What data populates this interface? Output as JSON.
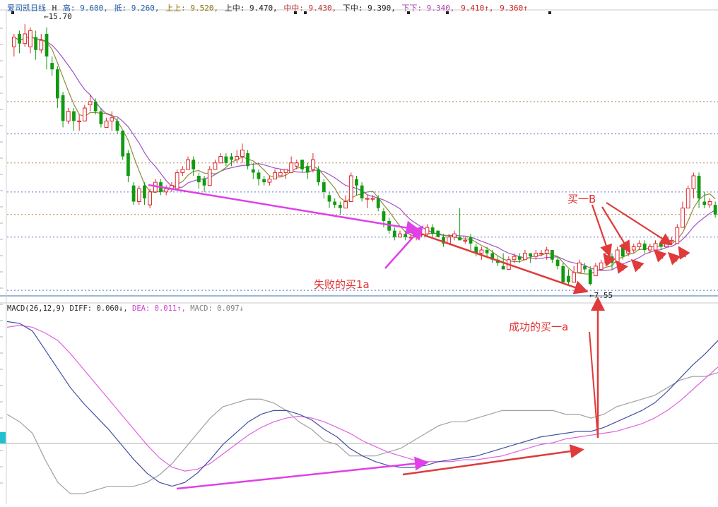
{
  "header": {
    "title": "爱司凯日线",
    "fields": [
      {
        "text": "H",
        "color": "#202020"
      },
      {
        "text": "高: 9.600,",
        "color": "#1e5aa8"
      },
      {
        "text": "抵: 9.260,",
        "color": "#1e5aa8"
      },
      {
        "text": "上上: 9.520,",
        "color": "#8a6a00"
      },
      {
        "text": "上中: 9.470,",
        "color": "#202020"
      },
      {
        "text": "中中: 9.430,",
        "color": "#c03030"
      },
      {
        "text": "下中: 9.390,",
        "color": "#202020"
      },
      {
        "text": "下下: 9.340,",
        "color": "#b040b0"
      },
      {
        "text": "9.410↑,",
        "color": "#d02020"
      },
      {
        "text": "9.360↑",
        "color": "#d02020"
      }
    ]
  },
  "macd_header": {
    "label": "MACD(26,12,9)",
    "diff": "DIFF: 0.060↓,",
    "dea": "DEA: 0.011↑,",
    "macd": "MACD: 0.097↓"
  },
  "price_labels": {
    "high": "15.70",
    "low": "7.55"
  },
  "annotations": {
    "failed_buy": "失败的买1a",
    "success_buy": "成功的买一a",
    "buy_b": "买一B"
  },
  "colors": {
    "up": "#e0242a",
    "down": "#109a10",
    "ma_fast": "#8c8c3a",
    "ma_slow": "#a050c8",
    "diff_line": "#4050a0",
    "dea_line": "#e060e0",
    "macd_line": "#a0a0a0",
    "magenta_arrow": "#e040e8",
    "red_arrow": "#e03a3a",
    "hgrid_brown": "#a06a2a",
    "hgrid_blue": "#3050c0"
  },
  "chart_data": [
    {
      "type": "candlestick",
      "title": "爱司凯日线",
      "ylim": [
        7.2,
        16.0
      ],
      "reference_levels": [
        13.2,
        12.2,
        11.3,
        10.4,
        9.7,
        9.0,
        7.35
      ],
      "candles": [
        [
          14.9,
          15.2,
          14.6,
          15.3
        ],
        [
          15.3,
          15.0,
          14.7,
          15.4
        ],
        [
          15.0,
          15.3,
          14.9,
          15.6
        ],
        [
          14.9,
          15.4,
          14.7,
          15.5
        ],
        [
          15.2,
          14.8,
          14.5,
          15.4
        ],
        [
          14.8,
          15.1,
          14.7,
          15.3
        ],
        [
          15.3,
          14.6,
          14.2,
          15.5
        ],
        [
          14.4,
          14.2,
          14.0,
          14.6
        ],
        [
          14.2,
          13.3,
          13.0,
          14.3
        ],
        [
          13.4,
          12.6,
          12.4,
          13.5
        ],
        [
          12.6,
          12.9,
          12.5,
          13.0
        ],
        [
          12.9,
          12.6,
          12.3,
          13.0
        ],
        [
          12.6,
          12.6,
          12.3,
          12.8
        ],
        [
          12.6,
          13.0,
          12.8,
          13.1
        ],
        [
          13.1,
          13.2,
          12.9,
          13.4
        ],
        [
          13.2,
          12.9,
          12.8,
          13.3
        ],
        [
          12.9,
          12.5,
          12.4,
          13.0
        ],
        [
          12.4,
          12.6,
          12.4,
          12.7
        ],
        [
          12.6,
          12.7,
          12.3,
          12.9
        ],
        [
          12.6,
          12.3,
          12.2,
          12.7
        ],
        [
          12.3,
          11.5,
          11.4,
          12.3
        ],
        [
          11.6,
          10.9,
          10.7,
          11.7
        ],
        [
          10.6,
          10.1,
          10.0,
          10.7
        ],
        [
          10.1,
          10.5,
          10.0,
          10.6
        ],
        [
          10.6,
          10.2,
          10.0,
          10.7
        ],
        [
          10.0,
          10.4,
          9.9,
          10.5
        ],
        [
          10.4,
          10.7,
          10.6,
          10.8
        ],
        [
          10.7,
          10.4,
          10.3,
          10.8
        ],
        [
          10.4,
          10.5,
          10.3,
          10.6
        ],
        [
          10.5,
          10.6,
          10.4,
          10.7
        ],
        [
          10.5,
          11.0,
          10.9,
          11.1
        ],
        [
          11.0,
          11.1,
          10.9,
          11.2
        ],
        [
          11.1,
          11.4,
          11.2,
          11.5
        ],
        [
          11.4,
          11.1,
          10.9,
          11.5
        ],
        [
          10.9,
          10.7,
          10.5,
          11.0
        ],
        [
          10.8,
          10.6,
          10.4,
          10.9
        ],
        [
          10.6,
          11.1,
          11.0,
          11.2
        ],
        [
          11.1,
          11.3,
          11.1,
          11.4
        ],
        [
          11.3,
          11.5,
          11.3,
          11.6
        ],
        [
          11.5,
          11.3,
          11.2,
          11.6
        ],
        [
          11.5,
          11.4,
          11.2,
          11.6
        ],
        [
          11.4,
          11.5,
          11.3,
          11.7
        ],
        [
          11.5,
          11.7,
          11.3,
          11.9
        ],
        [
          11.6,
          11.2,
          11.1,
          11.7
        ],
        [
          11.1,
          11.0,
          10.8,
          11.3
        ],
        [
          11.0,
          10.8,
          10.6,
          11.1
        ],
        [
          10.8,
          10.7,
          10.6,
          10.9
        ],
        [
          10.7,
          10.8,
          10.6,
          10.9
        ],
        [
          10.8,
          11.0,
          10.8,
          11.1
        ],
        [
          10.9,
          11.0,
          10.9,
          11.1
        ],
        [
          11.0,
          11.1,
          10.8,
          11.1
        ],
        [
          11.0,
          11.3,
          11.1,
          11.5
        ],
        [
          11.2,
          11.3,
          11.1,
          11.4
        ],
        [
          11.4,
          11.1,
          11.0,
          11.4
        ],
        [
          11.2,
          11.0,
          10.8,
          11.3
        ],
        [
          11.1,
          11.4,
          11.0,
          11.6
        ],
        [
          11.1,
          10.7,
          10.6,
          11.2
        ],
        [
          10.7,
          10.4,
          10.2,
          10.8
        ],
        [
          10.3,
          10.1,
          9.9,
          10.4
        ],
        [
          10.1,
          10.0,
          9.9,
          10.2
        ],
        [
          10.0,
          9.9,
          9.7,
          10.1
        ],
        [
          9.9,
          10.1,
          9.9,
          10.3
        ],
        [
          10.1,
          10.9,
          10.1,
          11.0
        ],
        [
          10.8,
          10.6,
          10.3,
          10.9
        ],
        [
          10.6,
          10.2,
          10.1,
          10.7
        ],
        [
          10.2,
          10.2,
          9.9,
          10.3
        ],
        [
          10.2,
          10.2,
          10.1,
          10.3
        ],
        [
          10.2,
          9.9,
          9.8,
          10.3
        ],
        [
          9.8,
          9.5,
          9.3,
          9.9
        ],
        [
          9.5,
          9.2,
          9.1,
          9.6
        ],
        [
          9.2,
          9.0,
          8.9,
          9.3
        ],
        [
          9.0,
          9.1,
          9.0,
          9.2
        ],
        [
          9.1,
          9.0,
          8.9,
          9.2
        ],
        [
          9.0,
          9.0,
          8.9,
          9.1
        ],
        [
          9.0,
          9.1,
          8.9,
          9.2
        ],
        [
          9.1,
          9.1,
          9.0,
          9.2
        ],
        [
          9.1,
          9.3,
          9.0,
          9.4
        ],
        [
          9.3,
          9.1,
          9.0,
          9.4
        ],
        [
          9.2,
          9.0,
          9.0,
          9.2
        ],
        [
          9.0,
          8.8,
          8.7,
          9.1
        ],
        [
          8.8,
          9.0,
          8.9,
          9.1
        ],
        [
          9.0,
          9.1,
          8.9,
          9.2
        ],
        [
          9.0,
          8.9,
          9.0,
          9.9
        ],
        [
          8.9,
          8.9,
          8.8,
          9.0
        ],
        [
          9.0,
          8.8,
          8.6,
          9.1
        ],
        [
          8.7,
          8.5,
          8.4,
          8.8
        ],
        [
          8.5,
          8.6,
          8.3,
          8.7
        ],
        [
          8.6,
          8.5,
          8.4,
          8.7
        ],
        [
          8.5,
          8.3,
          8.2,
          8.6
        ],
        [
          8.3,
          8.2,
          8.1,
          8.4
        ],
        [
          8.1,
          8.0,
          8.0,
          8.5
        ],
        [
          8.0,
          8.3,
          8.1,
          8.4
        ],
        [
          8.3,
          8.4,
          8.2,
          8.5
        ],
        [
          8.4,
          8.3,
          8.2,
          8.5
        ],
        [
          8.3,
          8.5,
          8.3,
          8.6
        ],
        [
          8.5,
          8.4,
          8.2,
          8.5
        ],
        [
          8.4,
          8.5,
          8.3,
          8.6
        ],
        [
          8.5,
          8.5,
          8.4,
          8.6
        ],
        [
          8.5,
          8.6,
          8.3,
          8.7
        ],
        [
          8.6,
          8.3,
          8.2,
          8.6
        ],
        [
          8.3,
          8.1,
          8.0,
          8.4
        ],
        [
          8.1,
          7.6,
          7.55,
          8.2
        ],
        [
          7.8,
          7.6,
          7.5,
          8.0
        ],
        [
          7.6,
          7.9,
          7.7,
          8.1
        ],
        [
          7.9,
          8.2,
          8.0,
          8.3
        ],
        [
          8.1,
          8.0,
          7.9,
          8.2
        ],
        [
          8.0,
          7.55,
          7.5,
          8.1
        ],
        [
          7.8,
          8.1,
          7.9,
          8.2
        ],
        [
          8.0,
          8.2,
          8.1,
          8.3
        ],
        [
          8.2,
          8.5,
          8.3,
          8.6
        ],
        [
          8.4,
          8.2,
          8.0,
          8.5
        ],
        [
          8.2,
          8.6,
          8.4,
          8.7
        ],
        [
          8.7,
          8.4,
          8.3,
          8.8
        ],
        [
          8.5,
          8.6,
          8.4,
          8.7
        ],
        [
          8.6,
          8.7,
          8.5,
          8.8
        ],
        [
          8.7,
          8.8,
          8.6,
          8.9
        ],
        [
          8.8,
          8.6,
          8.5,
          8.9
        ],
        [
          8.6,
          8.7,
          8.5,
          8.8
        ],
        [
          8.6,
          8.8,
          8.6,
          8.9
        ],
        [
          8.8,
          8.7,
          8.6,
          8.9
        ],
        [
          8.7,
          8.9,
          8.7,
          9.0
        ],
        [
          8.9,
          8.9,
          8.8,
          9.0
        ],
        [
          8.8,
          9.3,
          8.8,
          9.4
        ],
        [
          9.3,
          9.9,
          9.3,
          10.1
        ],
        [
          9.9,
          10.5,
          9.9,
          10.6
        ],
        [
          10.5,
          10.9,
          10.2,
          11.0
        ],
        [
          10.9,
          10.2,
          9.9,
          11.0
        ],
        [
          10.1,
          10.0,
          9.9,
          10.4
        ],
        [
          10.0,
          10.1,
          9.9,
          10.2
        ],
        [
          10.0,
          9.7,
          9.6,
          10.1
        ]
      ]
    },
    {
      "type": "line",
      "title": "MACD(26,12,9)",
      "series": [
        {
          "name": "DIFF",
          "values": [
            0.55,
            0.54,
            0.5,
            0.4,
            0.3,
            0.2,
            0.12,
            0.05,
            -0.02,
            -0.1,
            -0.18,
            -0.25,
            -0.3,
            -0.32,
            -0.3,
            -0.25,
            -0.18,
            -0.1,
            -0.04,
            0.02,
            0.06,
            0.08,
            0.08,
            0.06,
            0.03,
            -0.02,
            -0.06,
            -0.12,
            -0.16,
            -0.19,
            -0.21,
            -0.22,
            -0.22,
            -0.21,
            -0.19,
            -0.18,
            -0.17,
            -0.16,
            -0.14,
            -0.12,
            -0.1,
            -0.08,
            -0.06,
            -0.05,
            -0.04,
            -0.03,
            -0.03,
            -0.01,
            0.02,
            0.05,
            0.08,
            0.12,
            0.18,
            0.25,
            0.32,
            0.38,
            0.45
          ]
        },
        {
          "name": "DEA",
          "values": [
            0.52,
            0.53,
            0.52,
            0.49,
            0.45,
            0.38,
            0.3,
            0.22,
            0.14,
            0.06,
            -0.02,
            -0.1,
            -0.17,
            -0.22,
            -0.24,
            -0.23,
            -0.2,
            -0.15,
            -0.1,
            -0.05,
            -0.01,
            0.02,
            0.04,
            0.05,
            0.04,
            0.02,
            -0.01,
            -0.04,
            -0.08,
            -0.11,
            -0.14,
            -0.16,
            -0.18,
            -0.19,
            -0.19,
            -0.19,
            -0.18,
            -0.18,
            -0.17,
            -0.16,
            -0.14,
            -0.12,
            -0.1,
            -0.09,
            -0.07,
            -0.06,
            -0.05,
            -0.04,
            -0.03,
            -0.01,
            0.01,
            0.04,
            0.08,
            0.13,
            0.19,
            0.25,
            0.31
          ]
        },
        {
          "name": "MACD",
          "values": [
            0.06,
            0.02,
            -0.04,
            -0.18,
            -0.3,
            -0.36,
            -0.36,
            -0.34,
            -0.32,
            -0.32,
            -0.32,
            -0.3,
            -0.26,
            -0.2,
            -0.12,
            -0.04,
            0.04,
            0.1,
            0.12,
            0.14,
            0.14,
            0.12,
            0.08,
            0.02,
            -0.02,
            -0.08,
            -0.1,
            -0.16,
            -0.16,
            -0.16,
            -0.14,
            -0.12,
            -0.08,
            -0.04,
            0.0,
            0.02,
            0.02,
            0.04,
            0.06,
            0.08,
            0.08,
            0.08,
            0.08,
            0.08,
            0.06,
            0.06,
            0.04,
            0.06,
            0.1,
            0.12,
            0.14,
            0.16,
            0.2,
            0.24,
            0.26,
            0.26,
            0.28
          ]
        }
      ],
      "ylim": [
        -0.4,
        0.6
      ]
    }
  ]
}
